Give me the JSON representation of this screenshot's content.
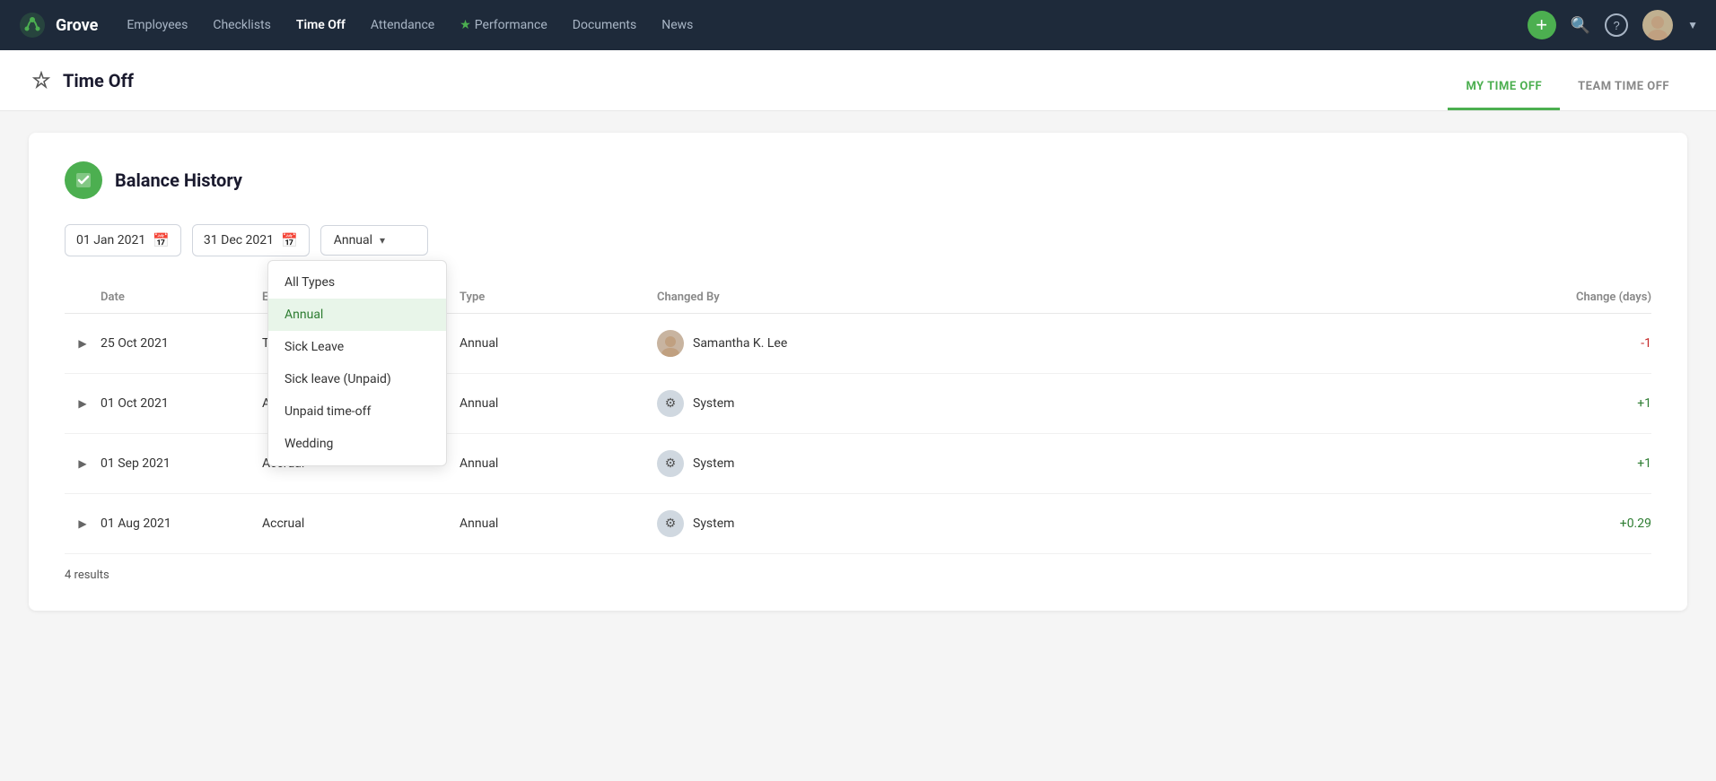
{
  "nav": {
    "logo": "Grove",
    "links": [
      {
        "label": "Employees",
        "active": false
      },
      {
        "label": "Checklists",
        "active": false
      },
      {
        "label": "Time Off",
        "active": true
      },
      {
        "label": "Attendance",
        "active": false
      },
      {
        "label": "Performance",
        "active": false,
        "star": true
      },
      {
        "label": "Documents",
        "active": false
      },
      {
        "label": "News",
        "active": false
      }
    ]
  },
  "subheader": {
    "page_title": "Time Off",
    "tabs": [
      {
        "label": "MY TIME OFF",
        "active": true
      },
      {
        "label": "TEAM TIME OFF",
        "active": false
      }
    ]
  },
  "content": {
    "section_title": "Balance History",
    "date_start": "01 Jan 2021",
    "date_end": "31 Dec 2021",
    "dropdown_selected": "Annual",
    "dropdown_options": [
      {
        "label": "All Types",
        "selected": false
      },
      {
        "label": "Annual",
        "selected": true
      },
      {
        "label": "Sick Leave",
        "selected": false
      },
      {
        "label": "Sick leave (Unpaid)",
        "selected": false
      },
      {
        "label": "Unpaid time-off",
        "selected": false
      },
      {
        "label": "Wedding",
        "selected": false
      }
    ],
    "table": {
      "headers": [
        "",
        "Date",
        "Event",
        "Type",
        "Changed By",
        "Change (days)"
      ],
      "rows": [
        {
          "date": "25 Oct 2021",
          "event": "Take Time Off",
          "type": "Annual",
          "changed_by": "Samantha K. Lee",
          "changed_by_type": "person",
          "change": "-1",
          "change_sign": "negative"
        },
        {
          "date": "01 Oct 2021",
          "event": "Accrual",
          "type": "Annual",
          "changed_by": "System",
          "changed_by_type": "system",
          "change": "+1",
          "change_sign": "positive"
        },
        {
          "date": "01 Sep 2021",
          "event": "Accrual",
          "type": "Annual",
          "changed_by": "System",
          "changed_by_type": "system",
          "change": "+1",
          "change_sign": "positive"
        },
        {
          "date": "01 Aug 2021",
          "event": "Accrual",
          "type": "Annual",
          "changed_by": "System",
          "changed_by_type": "system",
          "change": "+0.29",
          "change_sign": "positive"
        }
      ]
    },
    "results_count": "4 results"
  }
}
